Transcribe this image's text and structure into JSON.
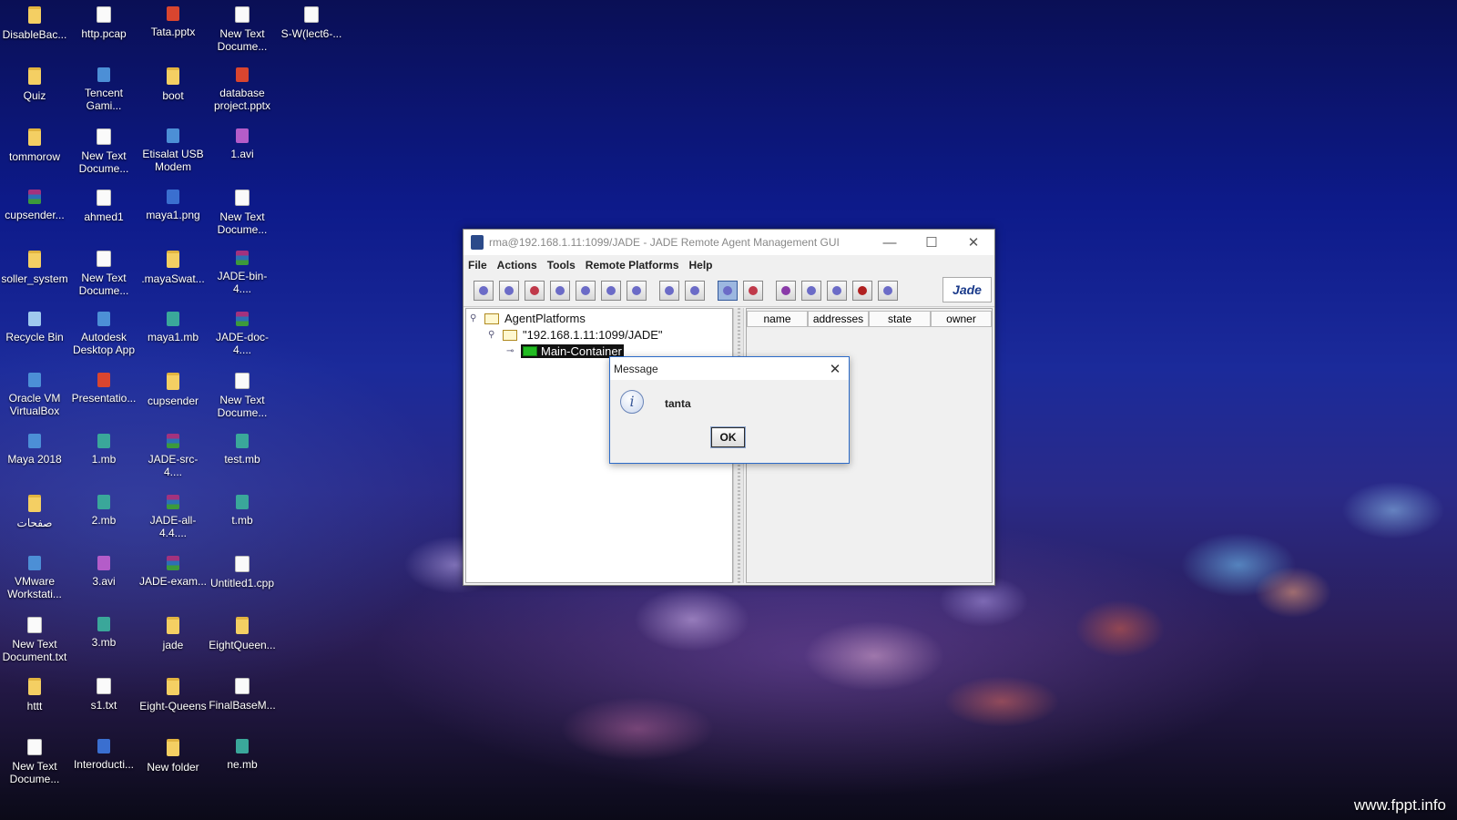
{
  "desktop": {
    "icons": [
      {
        "label": "DisableBac...",
        "icon": "folder-icon"
      },
      {
        "label": "http.pcap",
        "icon": "file-icon"
      },
      {
        "label": "Tata.pptx",
        "icon": "powerpoint-icon"
      },
      {
        "label": "New Text Docume...",
        "icon": "text-file-icon"
      },
      {
        "label": "S-W(lect6-...",
        "icon": "text-file-icon"
      },
      {
        "label": "Quiz",
        "icon": "folder-icon"
      },
      {
        "label": "Tencent Gami...",
        "icon": "app-icon"
      },
      {
        "label": "boot",
        "icon": "folder-icon"
      },
      {
        "label": "database project.pptx",
        "icon": "powerpoint-icon"
      },
      {
        "label": "tommorow",
        "icon": "folder-icon"
      },
      {
        "label": "New Text Docume...",
        "icon": "text-file-icon"
      },
      {
        "label": "Etisalat USB Modem",
        "icon": "app-icon"
      },
      {
        "label": "1.avi",
        "icon": "video-icon"
      },
      {
        "label": "cupsender...",
        "icon": "archive-icon"
      },
      {
        "label": "ahmed1",
        "icon": "file-icon"
      },
      {
        "label": "maya1.png",
        "icon": "image-icon"
      },
      {
        "label": "New Text Docume...",
        "icon": "text-file-icon"
      },
      {
        "label": "soller_system",
        "icon": "folder-icon"
      },
      {
        "label": "New Text Docume...",
        "icon": "text-file-icon"
      },
      {
        "label": ".mayaSwat...",
        "icon": "folder-icon"
      },
      {
        "label": "JADE-bin-4....",
        "icon": "archive-icon"
      },
      {
        "label": "Recycle Bin",
        "icon": "recycle-bin-icon"
      },
      {
        "label": "Autodesk Desktop App",
        "icon": "app-icon"
      },
      {
        "label": "maya1.mb",
        "icon": "maya-file-icon"
      },
      {
        "label": "JADE-doc-4....",
        "icon": "archive-icon"
      },
      {
        "label": "Oracle VM VirtualBox",
        "icon": "app-icon"
      },
      {
        "label": "Presentatio...",
        "icon": "powerpoint-icon"
      },
      {
        "label": "cupsender",
        "icon": "folder-icon"
      },
      {
        "label": "New Text Docume...",
        "icon": "text-file-icon"
      },
      {
        "label": "Maya 2018",
        "icon": "app-icon"
      },
      {
        "label": "1.mb",
        "icon": "maya-file-icon"
      },
      {
        "label": "JADE-src-4....",
        "icon": "archive-icon"
      },
      {
        "label": "test.mb",
        "icon": "maya-file-icon"
      },
      {
        "label": "صفحات",
        "icon": "folder-icon"
      },
      {
        "label": "2.mb",
        "icon": "maya-file-icon"
      },
      {
        "label": "JADE-all-4.4....",
        "icon": "archive-icon"
      },
      {
        "label": "t.mb",
        "icon": "maya-file-icon"
      },
      {
        "label": "VMware Workstati...",
        "icon": "app-icon"
      },
      {
        "label": "3.avi",
        "icon": "video-icon"
      },
      {
        "label": "JADE-exam...",
        "icon": "archive-icon"
      },
      {
        "label": "Untitled1.cpp",
        "icon": "cpp-file-icon"
      },
      {
        "label": "New Text Document.txt",
        "icon": "text-file-icon"
      },
      {
        "label": "3.mb",
        "icon": "maya-file-icon"
      },
      {
        "label": "jade",
        "icon": "folder-icon"
      },
      {
        "label": "EightQueen...",
        "icon": "folder-icon"
      },
      {
        "label": "httt",
        "icon": "folder-icon"
      },
      {
        "label": "s1.txt",
        "icon": "text-file-icon"
      },
      {
        "label": "Eight-Queens",
        "icon": "folder-icon"
      },
      {
        "label": "FinalBaseM...",
        "icon": "file-icon"
      },
      {
        "label": "New Text Docume...",
        "icon": "text-file-icon"
      },
      {
        "label": "Interoducti...",
        "icon": "word-icon"
      },
      {
        "label": "New folder",
        "icon": "folder-icon"
      },
      {
        "label": "ne.mb",
        "icon": "maya-file-icon"
      }
    ]
  },
  "window": {
    "title": "rma@192.168.1.11:1099/JADE - JADE Remote Agent Management GUI",
    "minimize": "—",
    "maximize": "☐",
    "close": "✕",
    "menu": [
      "File",
      "Actions",
      "Tools",
      "Remote Platforms",
      "Help"
    ],
    "logo_text": "Jade",
    "tree": {
      "root": "AgentPlatforms",
      "platform": "\"192.168.1.11:1099/JADE\"",
      "container": "Main-Container"
    },
    "table_headers": [
      "name",
      "addresses",
      "state",
      "owner"
    ]
  },
  "dialog": {
    "title": "Message",
    "close": "✕",
    "icon_glyph": "i",
    "message": "tanta",
    "ok_label": "OK"
  },
  "watermark": "www.fppt.info"
}
